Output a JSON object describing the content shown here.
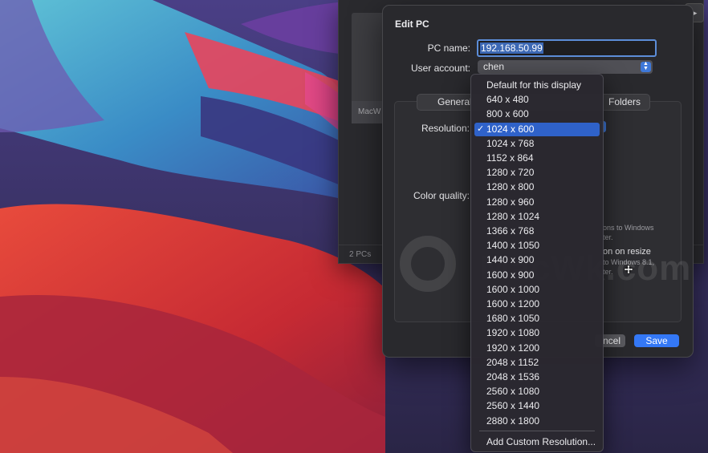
{
  "background_window": {
    "thumbnail_label": "MacW",
    "footer_count": "2 PCs",
    "play_icon": "play-icon"
  },
  "sheet": {
    "title": "Edit PC",
    "pc_name_label": "PC name:",
    "pc_name_value": "192.168.50.99",
    "user_account_label": "User account:",
    "user_account_value": "chen",
    "tabs": {
      "general": "General",
      "folders": "Folders"
    },
    "resolution_label": "Resolution:",
    "color_quality_label": "Color quality:",
    "note_a_line1": "ons to Windows",
    "note_a_line2": "ter.",
    "resize_option": "on on resize",
    "note_b_line1": "to Windows 8.1,",
    "note_b_line2": "ter.",
    "cancel_label": "ncel",
    "save_label": "Save"
  },
  "watermark": {
    "text": "MacWk.com"
  },
  "resolution_menu": {
    "selected": "1024 x 600",
    "check_mark": "✓",
    "items": [
      "Default for this display",
      "640 x 480",
      "800 x 600",
      "1024 x 600",
      "1024 x 768",
      "1152 x 864",
      "1280 x 720",
      "1280 x 800",
      "1280 x 960",
      "1280 x 1024",
      "1366 x 768",
      "1400 x 1050",
      "1440 x 900",
      "1600 x 900",
      "1600 x 1000",
      "1600 x 1200",
      "1680 x 1050",
      "1920 x 1080",
      "1920 x 1200",
      "2048 x 1152",
      "2048 x 1536",
      "2560 x 1080",
      "2560 x 1440",
      "2880 x 1800"
    ],
    "custom_item": "Add Custom Resolution..."
  },
  "colors": {
    "accent": "#3478f6",
    "menu_highlight": "#2f62c9",
    "sheet_bg": "#29292d"
  }
}
